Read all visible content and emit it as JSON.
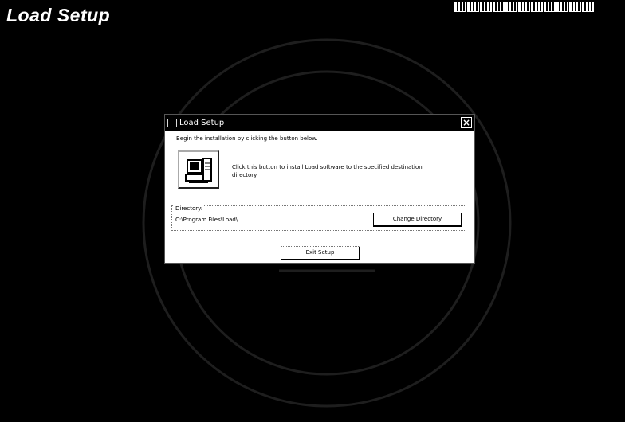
{
  "screen": {
    "title": "Load Setup",
    "tray_icon_count": 11
  },
  "dialog": {
    "title": "Load Setup",
    "close_glyph": "×",
    "intro_text": "Begin the installation by clicking the button below.",
    "install_description": "Click this button to install Load software to the specified destination directory.",
    "directory_label": "Directory:",
    "directory_path": "C:\\Program Files\\Load\\",
    "change_directory_label": "Change Directory",
    "exit_setup_label": "Exit Setup"
  },
  "colors": {
    "background": "#000000",
    "dialog_background": "#ffffff",
    "titlebar": "#000000"
  },
  "icons": {
    "setup": "computer-setup-icon",
    "app": "setup-app-icon",
    "close": "close-icon",
    "watermark": "university-seal-watermark"
  }
}
